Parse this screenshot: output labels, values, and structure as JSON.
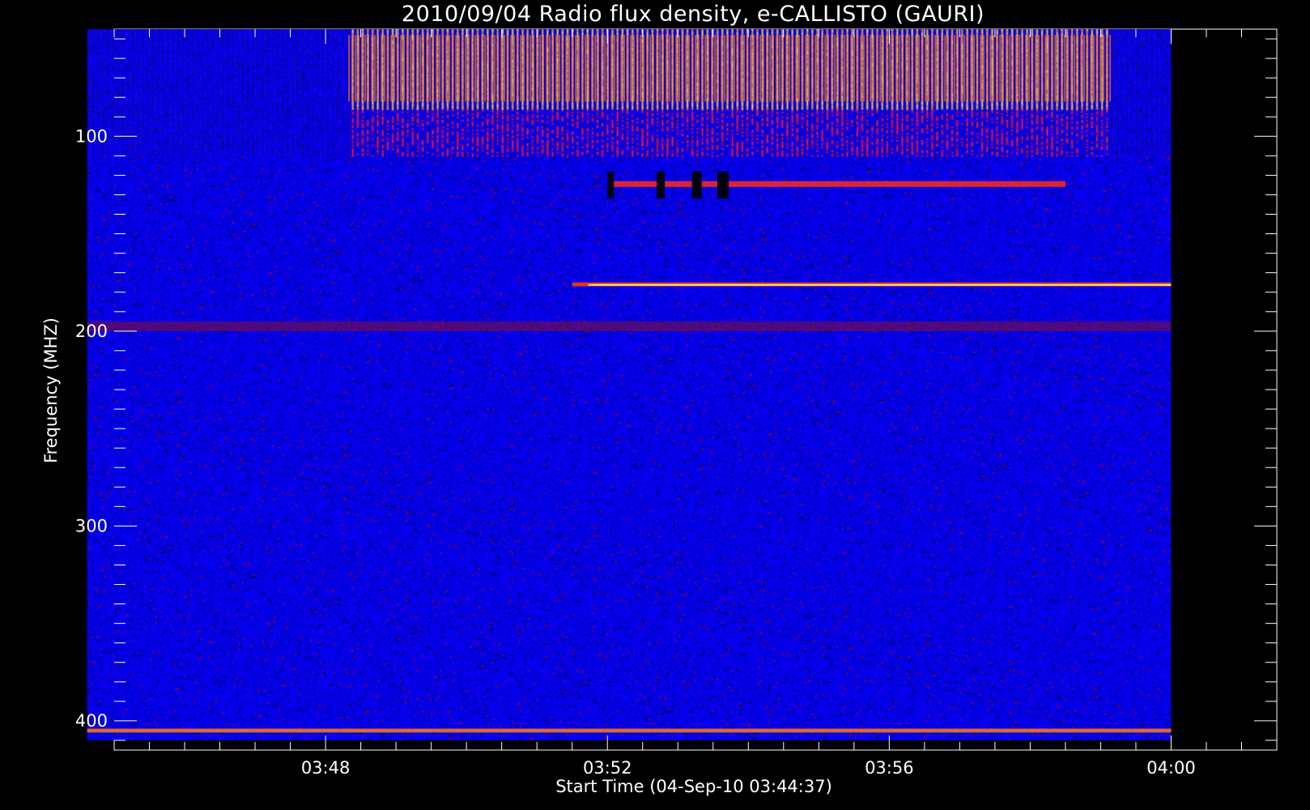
{
  "chart_data": {
    "type": "heatmap",
    "title": "2010/09/04  Radio flux density, e-CALLISTO (GAURI)",
    "xlabel": "Start Time (04-Sep-10 03:44:37)",
    "ylabel": "Frequency (MHZ)",
    "x_unit": "time (HH:MM, UT)",
    "xlim": [
      "03:45:00",
      "04:01:30"
    ],
    "ylim": [
      45,
      415
    ],
    "y_inverted": true,
    "x_ticks": [
      "03:48",
      "03:52",
      "03:56",
      "04:00"
    ],
    "y_ticks": [
      100,
      200,
      300,
      400
    ],
    "data_extent": {
      "time": [
        "03:44:37",
        "04:00:00"
      ],
      "frequency_mhz": [
        45,
        410
      ]
    },
    "grid": false,
    "colormap": [
      "#000040",
      "#0000ff",
      "#ff0000",
      "#ffff00",
      "#ffffff"
    ],
    "background_level": "blue",
    "features": [
      {
        "label": "interference comb",
        "time": [
          "03:48:20",
          "03:59:10"
        ],
        "frequency_mhz": [
          48,
          110
        ],
        "level": "red-yellow"
      },
      {
        "label": "persistent band",
        "time": [
          "03:51:30",
          "04:00:00"
        ],
        "frequency_mhz": [
          175,
          177
        ],
        "level": "yellow-white"
      },
      {
        "label": "intermittent emission",
        "time": [
          "03:52:00",
          "03:58:30"
        ],
        "frequency_mhz": [
          123,
          126
        ],
        "level": "red"
      },
      {
        "label": "faint band",
        "time": [
          "03:44:37",
          "04:00:00"
        ],
        "frequency_mhz": [
          195,
          200
        ],
        "level": "dark red"
      },
      {
        "label": "band edge",
        "time": [
          "03:44:37",
          "04:00:00"
        ],
        "frequency_mhz": [
          404,
          406
        ],
        "level": "red-yellow"
      },
      {
        "label": "dropout",
        "time": [
          "03:52:00",
          "03:54:00"
        ],
        "frequency_mhz": [
          118,
          132
        ],
        "level": "black"
      }
    ]
  }
}
